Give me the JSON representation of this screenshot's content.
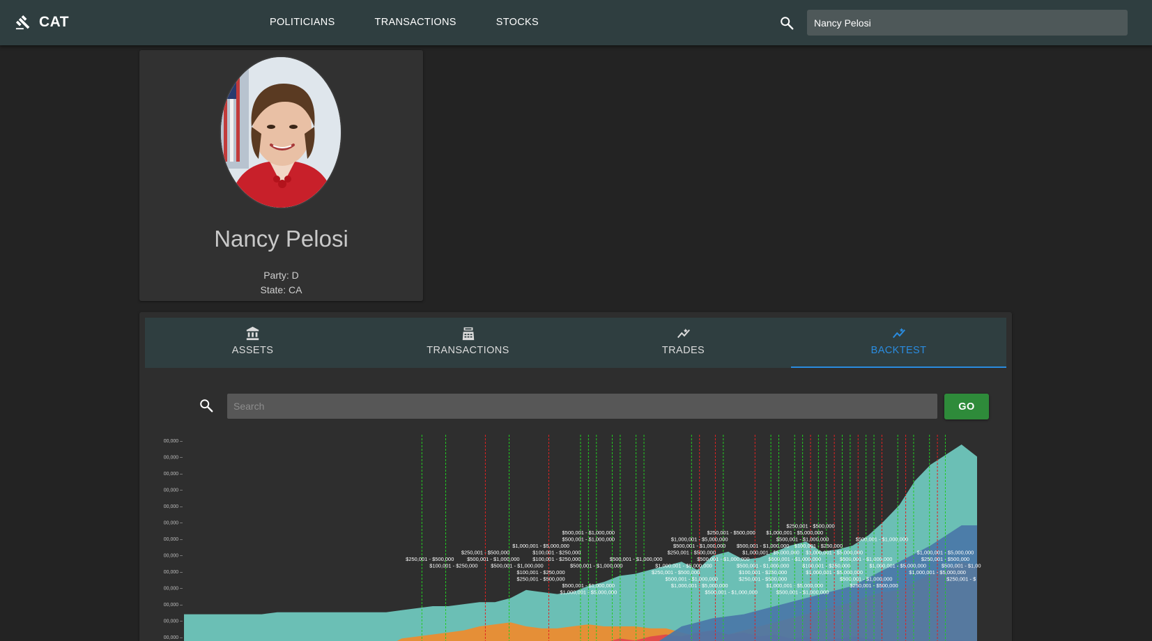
{
  "navbar": {
    "brand": "CAT",
    "brand_icon": "gavel-icon",
    "links": [
      "POLITICIANS",
      "TRANSACTIONS",
      "STOCKS"
    ],
    "search_value": "Nancy Pelosi"
  },
  "profile": {
    "name": "Nancy Pelosi",
    "party": "Party: D",
    "state": "State: CA"
  },
  "tabs": [
    {
      "label": "ASSETS",
      "icon": "bank-icon"
    },
    {
      "label": "TRANSACTIONS",
      "icon": "cash-register-icon"
    },
    {
      "label": "TRADES",
      "icon": "trending-icon"
    },
    {
      "label": "BACKTEST",
      "icon": "chart-line-icon",
      "active": true
    }
  ],
  "backtest": {
    "search_placeholder": "Search",
    "go_label": "GO"
  },
  "colors": {
    "navbar": "#2f3e40",
    "accent": "#2a8ce0",
    "go": "#2e8b3a",
    "series_teal": "#6fc7bd",
    "series_orange": "#f08b2c",
    "series_red": "#e0474c",
    "series_blue": "#4a77a8",
    "buy_line": "#22cc22",
    "sell_line": "#e02222"
  },
  "chart_data": {
    "type": "area",
    "ytick_labels": [
      "00,000",
      "00,000",
      "00,000",
      "00,000",
      "00,000",
      "00,000",
      "00,000",
      "00,000",
      "00,000",
      "00,000",
      "00,000",
      "00,000",
      "00,000"
    ],
    "series": [
      {
        "color": "teal",
        "values": [
          0.16,
          0.16,
          0.16,
          0.16,
          0.16,
          0.16,
          0.17,
          0.17,
          0.17,
          0.17,
          0.17,
          0.17,
          0.17,
          0.17,
          0.18,
          0.19,
          0.2,
          0.2,
          0.21,
          0.22,
          0.22,
          0.24,
          0.28,
          0.27,
          0.26,
          0.27,
          0.3,
          0.32,
          0.35,
          0.36,
          0.38,
          0.4,
          0.42,
          0.38,
          0.45,
          0.47,
          0.43,
          0.44,
          0.47,
          0.5,
          0.52,
          0.47,
          0.48,
          0.5,
          0.55,
          0.62,
          0.7,
          0.82,
          0.9,
          0.95,
          1.0,
          0.94
        ]
      },
      {
        "color": "orange",
        "values": [
          0,
          0,
          0,
          0,
          0,
          0,
          0,
          0,
          0,
          0,
          0,
          0,
          0,
          0,
          0.04,
          0.05,
          0.06,
          0.07,
          0.08,
          0.1,
          0.11,
          0.12,
          0.1,
          0.09,
          0.09,
          0.1,
          0.11,
          0.1,
          0.1,
          0.1,
          0.09,
          0.09,
          0.07,
          0.05,
          0.05,
          0.06,
          0.08,
          0.1,
          0.12,
          0.14,
          0.16,
          0.18,
          0.2,
          0.22,
          0.25,
          0.27,
          0.28,
          0.32,
          0.36,
          0.38,
          0.42,
          0.4
        ]
      },
      {
        "color": "red",
        "values": [
          0,
          0,
          0,
          0,
          0,
          0,
          0,
          0,
          0,
          0,
          0,
          0,
          0,
          0,
          0,
          0,
          0,
          0,
          0,
          0,
          0,
          0,
          0,
          0,
          0,
          0,
          0,
          0.02,
          0.04,
          0.03,
          0.05,
          0.06,
          0.05,
          0.07,
          0.08,
          0.06,
          0.07,
          0.05,
          0.06,
          0.04,
          0.05,
          0.03,
          0.04,
          0.05,
          0.04,
          0.03,
          0.03,
          0.02,
          0.02,
          0.03,
          0.03,
          0.02
        ]
      },
      {
        "color": "blue",
        "values": [
          0,
          0,
          0,
          0,
          0,
          0,
          0,
          0,
          0,
          0,
          0,
          0,
          0,
          0,
          0,
          0,
          0,
          0,
          0,
          0,
          0,
          0,
          0,
          0,
          0,
          0,
          0,
          0,
          0,
          0,
          0,
          0.05,
          0.1,
          0.12,
          0.14,
          0.15,
          0.16,
          0.18,
          0.2,
          0.22,
          0.24,
          0.26,
          0.28,
          0.3,
          0.34,
          0.38,
          0.42,
          0.46,
          0.5,
          0.55,
          0.6,
          0.6
        ]
      }
    ],
    "buy_markers": [
      0.3,
      0.33,
      0.41,
      0.5,
      0.51,
      0.52,
      0.54,
      0.55,
      0.57,
      0.58,
      0.64,
      0.68,
      0.74,
      0.75,
      0.77,
      0.78,
      0.8,
      0.81,
      0.83,
      0.84,
      0.86,
      0.87,
      0.9,
      0.92,
      0.94,
      0.96
    ],
    "sell_markers": [
      0.38,
      0.46,
      0.65,
      0.67,
      0.72,
      0.79,
      0.82,
      0.85,
      0.88,
      0.91,
      0.95
    ],
    "amount_labels": [
      {
        "t": "$500,001 - $1,000,000",
        "x": 0.51,
        "row": 0
      },
      {
        "t": "$500,001 - $1,000,000",
        "x": 0.51,
        "row": 1
      },
      {
        "t": "$250,001 - $500,000",
        "x": 0.69,
        "row": 0
      },
      {
        "t": "$1,000,001 - $5,000,000",
        "x": 0.65,
        "row": 1
      },
      {
        "t": "$1,000,001 - $5,000,000",
        "x": 0.77,
        "row": 0
      },
      {
        "t": "$250,001 - $500,000",
        "x": 0.79,
        "row": -1
      },
      {
        "t": "$500,001 - $1,000,000",
        "x": 0.78,
        "row": 1
      },
      {
        "t": "$500,001 - $1,000,000",
        "x": 0.88,
        "row": 1
      },
      {
        "t": "$1,000,001 - $5,000,000",
        "x": 0.45,
        "row": 2
      },
      {
        "t": "$500,001 - $1,000,000",
        "x": 0.65,
        "row": 2
      },
      {
        "t": "$500,001 - $1,000,000",
        "x": 0.73,
        "row": 2
      },
      {
        "t": "$100,001 - $250,000",
        "x": 0.8,
        "row": 2
      },
      {
        "t": "$250,001 - $500,000",
        "x": 0.38,
        "row": 3
      },
      {
        "t": "$100,001 - $250,000",
        "x": 0.47,
        "row": 3
      },
      {
        "t": "$250,001 - $500,000",
        "x": 0.64,
        "row": 3
      },
      {
        "t": "$1,000,001 - $5,000,000",
        "x": 0.74,
        "row": 3
      },
      {
        "t": "$1,000,001 - $5,000,000",
        "x": 0.82,
        "row": 3
      },
      {
        "t": "$1,000,001 - $5,000,000",
        "x": 0.96,
        "row": 3
      },
      {
        "t": "$250,001 - $500,000",
        "x": 0.31,
        "row": 4
      },
      {
        "t": "$500,001 - $1,000,000",
        "x": 0.39,
        "row": 4
      },
      {
        "t": "$100,001 - $250,000",
        "x": 0.47,
        "row": 4
      },
      {
        "t": "$500,001 - $1,000,000",
        "x": 0.57,
        "row": 4
      },
      {
        "t": "$500,001 - $1,000,000",
        "x": 0.68,
        "row": 4
      },
      {
        "t": "$500,001 - $1,000,000",
        "x": 0.77,
        "row": 4
      },
      {
        "t": "$500,001 - $1,000,000",
        "x": 0.86,
        "row": 4
      },
      {
        "t": "$250,001 - $500,000",
        "x": 0.96,
        "row": 4
      },
      {
        "t": "$100,001 - $250,000",
        "x": 0.34,
        "row": 5
      },
      {
        "t": "$500,001 - $1,000,000",
        "x": 0.42,
        "row": 5
      },
      {
        "t": "$500,001 - $1,000,000",
        "x": 0.52,
        "row": 5
      },
      {
        "t": "$1,000,001 - $5,000,000",
        "x": 0.63,
        "row": 5
      },
      {
        "t": "$500,001 - $1,000,000",
        "x": 0.73,
        "row": 5
      },
      {
        "t": "$100,001 - $250,000",
        "x": 0.81,
        "row": 5
      },
      {
        "t": "$1,000,001 - $5,000,000",
        "x": 0.9,
        "row": 5
      },
      {
        "t": "$500,001 - $1,00",
        "x": 0.98,
        "row": 5
      },
      {
        "t": "$100,001 - $250,000",
        "x": 0.45,
        "row": 6
      },
      {
        "t": "$250,001 - $500,000",
        "x": 0.62,
        "row": 6
      },
      {
        "t": "$100,001 - $250,000",
        "x": 0.73,
        "row": 6
      },
      {
        "t": "$1,000,001 - $5,000,000",
        "x": 0.82,
        "row": 6
      },
      {
        "t": "$1,000,001 - $5,000,000",
        "x": 0.95,
        "row": 6
      },
      {
        "t": "$250,001 - $500,000",
        "x": 0.45,
        "row": 7
      },
      {
        "t": "$500,001 - $1,000,000",
        "x": 0.64,
        "row": 7
      },
      {
        "t": "$250,001 - $500,000",
        "x": 0.73,
        "row": 7
      },
      {
        "t": "$500,001 - $1,000,000",
        "x": 0.86,
        "row": 7
      },
      {
        "t": "$250,001 - $",
        "x": 0.98,
        "row": 7
      },
      {
        "t": "$500,001 - $1,000,000",
        "x": 0.51,
        "row": 8
      },
      {
        "t": "$1,000,001 - $5,000,000",
        "x": 0.65,
        "row": 8
      },
      {
        "t": "$1,000,001 - $5,000,000",
        "x": 0.77,
        "row": 8
      },
      {
        "t": "$250,001 - $500,000",
        "x": 0.87,
        "row": 8
      },
      {
        "t": "$1,000,001 - $5,000,000",
        "x": 0.51,
        "row": 9
      },
      {
        "t": "$500,001 - $1,000,000",
        "x": 0.69,
        "row": 9
      },
      {
        "t": "$500,001 - $1,000,000",
        "x": 0.78,
        "row": 9
      }
    ]
  }
}
